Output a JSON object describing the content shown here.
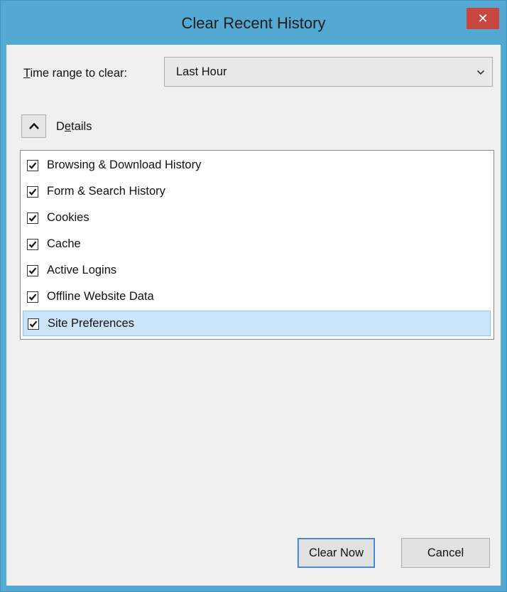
{
  "window": {
    "title": "Clear Recent History",
    "close_glyph": "✕",
    "close_icon": "close-icon",
    "accent_color": "#54a9d3",
    "close_color": "#c7463e"
  },
  "time_range": {
    "label_mnemonic": "T",
    "label_rest": "ime range to clear:",
    "selected": "Last Hour",
    "dropdown_icon": "chevron-down-icon"
  },
  "details": {
    "label_pre": "D",
    "label_mnemonic": "e",
    "label_post": "tails",
    "expanded": true,
    "toggle_icon": "chevron-up-icon"
  },
  "items": [
    {
      "label": "Browsing & Download History",
      "checked": true
    },
    {
      "label": "Form & Search History",
      "checked": true
    },
    {
      "label": "Cookies",
      "checked": true
    },
    {
      "label": "Cache",
      "checked": true
    },
    {
      "label": "Active Logins",
      "checked": true
    },
    {
      "label": "Offline Website Data",
      "checked": true
    },
    {
      "label": "Site Preferences",
      "checked": true,
      "selected": true
    }
  ],
  "buttons": {
    "clear_now": "Clear Now",
    "cancel": "Cancel"
  }
}
